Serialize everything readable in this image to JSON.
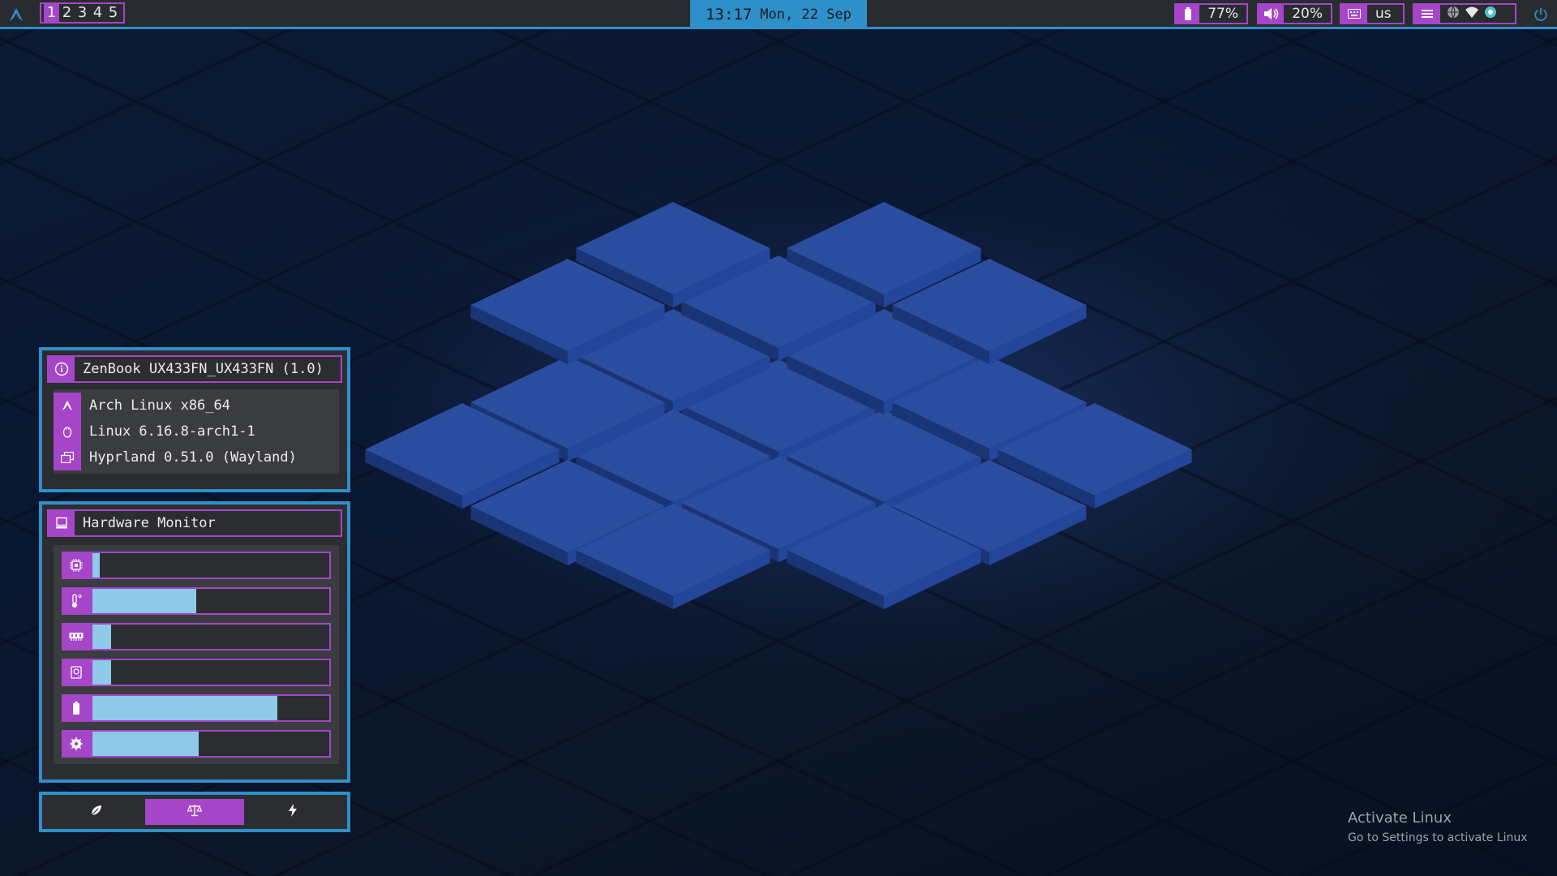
{
  "topbar": {
    "workspaces": [
      "1",
      "2",
      "3",
      "4",
      "5"
    ],
    "active_workspace": "1",
    "clock": {
      "time": "13:17",
      "date": "Mon, 22 Sep"
    },
    "battery": {
      "icon": "battery-icon",
      "value": "77%"
    },
    "volume": {
      "icon": "volume-icon",
      "value": "20%"
    },
    "keyboard": {
      "icon": "keyboard-icon",
      "value": "us"
    },
    "tray": {
      "icons": [
        "tray-menu-icon",
        "globe-icon",
        "wifi-icon",
        "status-icon"
      ]
    }
  },
  "sysinfo": {
    "title": "ZenBook UX433FN_UX433FN (1.0)",
    "rows": [
      {
        "icon": "arch-icon",
        "label": "Arch Linux x86_64"
      },
      {
        "icon": "tux-icon",
        "label": "Linux 6.16.8-arch1-1"
      },
      {
        "icon": "windows-stack-icon",
        "label": "Hyprland 0.51.0 (Wayland)"
      }
    ]
  },
  "hardware": {
    "title": "Hardware Monitor",
    "bars": [
      {
        "icon": "cpu-icon",
        "percent": 3
      },
      {
        "icon": "temperature-icon",
        "percent": 44
      },
      {
        "icon": "memory-icon",
        "percent": 8
      },
      {
        "icon": "disk-icon",
        "percent": 8
      },
      {
        "icon": "battery-icon",
        "percent": 78
      },
      {
        "icon": "gpu-icon",
        "percent": 45
      }
    ]
  },
  "power_profiles": {
    "options": [
      "leaf-icon",
      "balance-scale-icon",
      "lightning-icon"
    ],
    "active": "balance-scale-icon"
  },
  "watermark": {
    "line1": "Activate Linux",
    "line2": "Go to Settings to activate Linux"
  },
  "colors": {
    "accent_purple": "#a545c8",
    "accent_blue": "#2e8fc9",
    "bar_fill": "#8ec9ea",
    "panel_bg": "#2b2d31"
  }
}
